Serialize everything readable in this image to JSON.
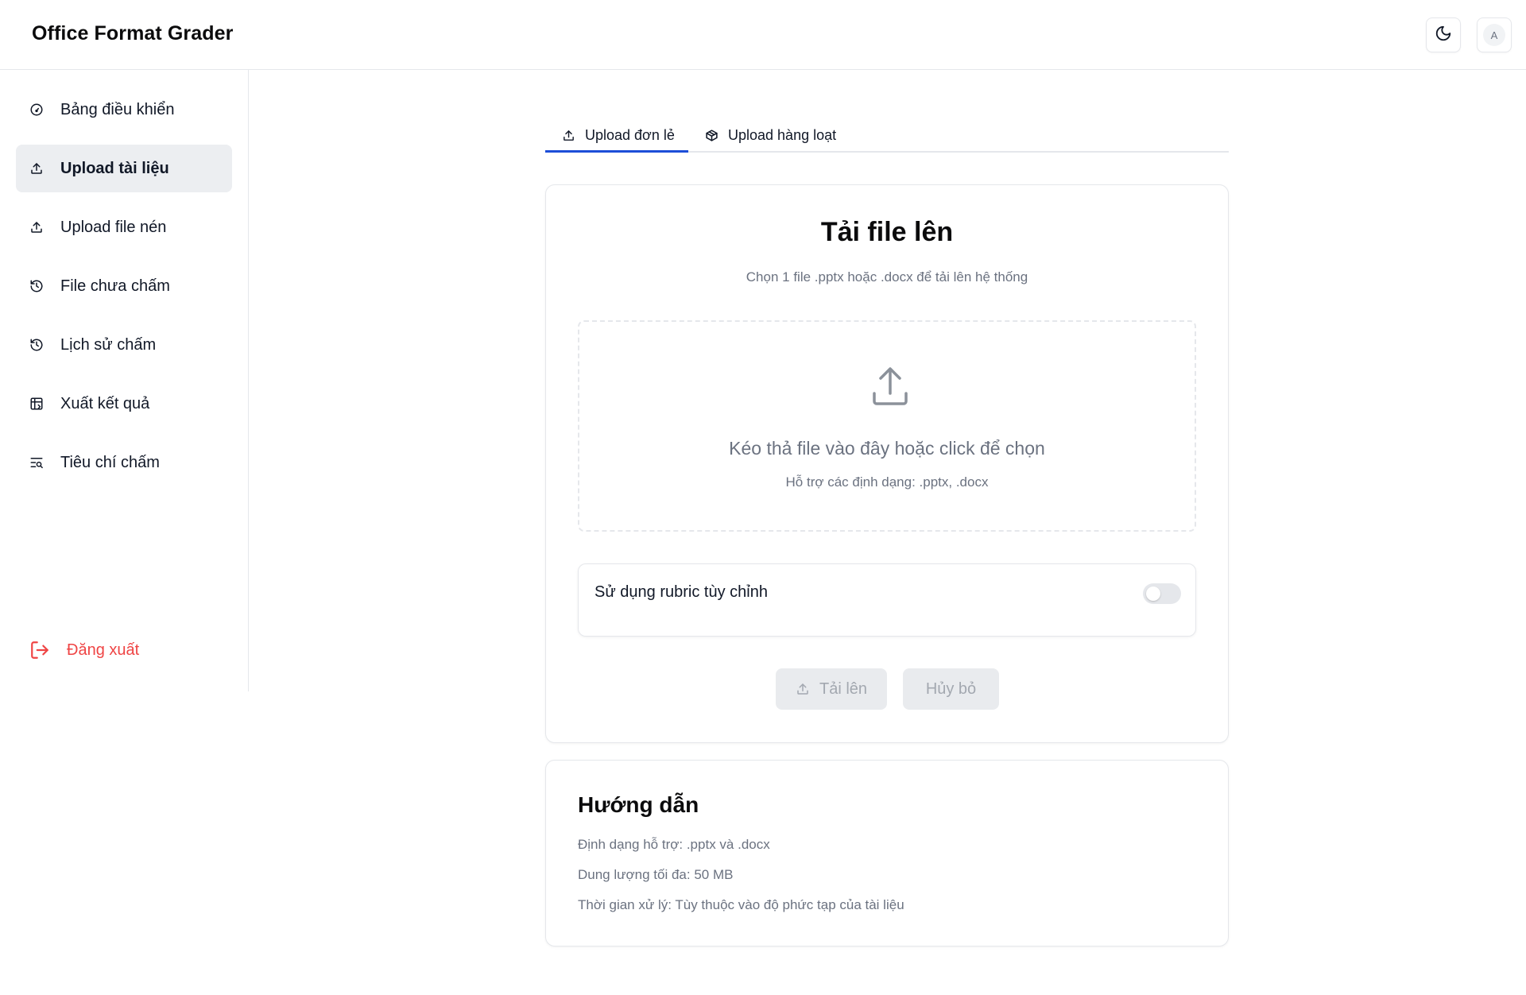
{
  "header": {
    "app_title": "Office Format Grader",
    "avatar_initial": "A"
  },
  "sidebar": {
    "items": [
      {
        "label": "Bảng điều khiển",
        "icon": "gauge-icon"
      },
      {
        "label": "Upload tài liệu",
        "icon": "upload-icon",
        "active": true
      },
      {
        "label": "Upload file nén",
        "icon": "upload-icon"
      },
      {
        "label": "File chưa chấm",
        "icon": "history-icon"
      },
      {
        "label": "Lịch sử chấm",
        "icon": "history-icon"
      },
      {
        "label": "Xuất kết quả",
        "icon": "table-icon"
      },
      {
        "label": "Tiêu chí chấm",
        "icon": "text-search-icon"
      }
    ],
    "logout_label": "Đăng xuất"
  },
  "tabs": {
    "single": "Upload đơn lẻ",
    "batch": "Upload hàng loạt",
    "active": "single"
  },
  "upload_card": {
    "title": "Tải file lên",
    "subtitle": "Chọn 1 file .pptx hoặc .docx để tải lên hệ thống",
    "dropzone_text": "Kéo thả file vào đây hoặc click để chọn",
    "dropzone_hint": "Hỗ trợ các định dạng: .pptx, .docx",
    "rubric_label": "Sử dụng rubric tùy chỉnh",
    "rubric_enabled": false,
    "upload_button": "Tải lên",
    "cancel_button": "Hủy bỏ"
  },
  "guide_card": {
    "title": "Hướng dẫn",
    "lines": [
      "Định dạng hỗ trợ: .pptx và .docx",
      "Dung lượng tối đa: 50 MB",
      "Thời gian xử lý: Tùy thuộc vào độ phức tạp của tài liệu"
    ]
  },
  "colors": {
    "accent": "#1d4ed8",
    "danger": "#ef4444",
    "active_bg": "#eceef1",
    "muted_text": "#6b7280"
  }
}
